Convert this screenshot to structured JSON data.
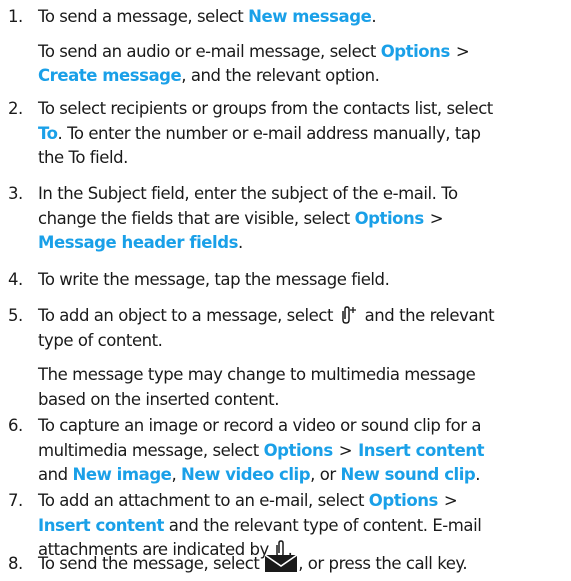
{
  "colors": {
    "text": "#1a1a1a",
    "highlight": "#1aa0e8"
  },
  "icons": {
    "attach_plus": "paperclip-plus-icon",
    "attach": "paperclip-icon",
    "send": "envelope-icon"
  },
  "steps": [
    {
      "num": "1.",
      "t1": "To send a message, select ",
      "h1": "New message",
      "t2": "."
    },
    {
      "note_t1": "To send an audio or e-mail message, select ",
      "note_h1": "Options",
      "note_sep": ">",
      "note_h2": "Create message",
      "note_t2": ", and the relevant option."
    },
    {
      "num": "2.",
      "l1": "To select recipients or groups from the contacts list, select",
      "h1": "To",
      "l2": ". To enter the number or e-mail address manually, tap",
      "l3": "the To field."
    },
    {
      "num": "3.",
      "l1": "In the Subject field, enter the subject of the e-mail. To",
      "l2": "change the fields that are visible, select ",
      "h1": "Options",
      "sep": ">",
      "h2": "Message header fields",
      "t3": "."
    },
    {
      "num": "4.",
      "l1": "To write the message, tap the message field."
    },
    {
      "num": "5.",
      "l1a": "To add an object to a message, select ",
      "l1b": " and the relevant",
      "l2": "type of content.",
      "n1": "The message type may change to multimedia message",
      "n2": "based on the inserted content."
    },
    {
      "num": "6.",
      "l1": "To capture an image or record a video or sound clip for a",
      "l2": "multimedia message, select ",
      "h1": "Options",
      "sep": ">",
      "h2": "Insert content",
      "l3a": "and ",
      "h3": "New image",
      "l3b": ", ",
      "h4": "New video clip",
      "l3c": ", or ",
      "h5": "New sound clip",
      "l3d": "."
    },
    {
      "num": "7.",
      "l1": "To add an attachment to an e-mail, select ",
      "h1": "Options",
      "sep": ">",
      "h2": "Insert content",
      "l2": " and the relevant type of content. E-mail",
      "l3": "attachments are indicated by ",
      "l3end": "."
    },
    {
      "num": "8.",
      "l1a": "To send the message, select ",
      "l1b": ", or press the call key."
    }
  ]
}
